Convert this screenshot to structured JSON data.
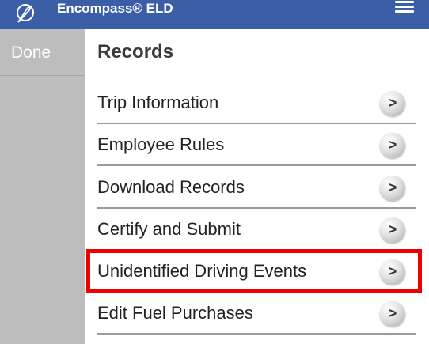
{
  "header": {
    "title": "Encompass® ELD",
    "logo_icon": "feather-logo-icon",
    "menu_icon": "hamburger-menu-icon",
    "color": "#3a5fa6"
  },
  "sidebar": {
    "done_label": "Done"
  },
  "main": {
    "title": "Records",
    "items": [
      {
        "label": "Trip Information",
        "icon": "chevron-right-icon",
        "glyph": ">"
      },
      {
        "label": "Employee Rules",
        "icon": "chevron-right-icon",
        "glyph": ">"
      },
      {
        "label": "Download Records",
        "icon": "chevron-right-icon",
        "glyph": ">"
      },
      {
        "label": "Certify and Submit",
        "icon": "chevron-right-icon",
        "glyph": ">"
      },
      {
        "label": "Unidentified Driving Events",
        "icon": "chevron-right-icon",
        "glyph": ">",
        "highlighted": true
      },
      {
        "label": "Edit Fuel Purchases",
        "icon": "chevron-right-icon",
        "glyph": ">"
      }
    ]
  },
  "highlight_color": "#ee0000"
}
